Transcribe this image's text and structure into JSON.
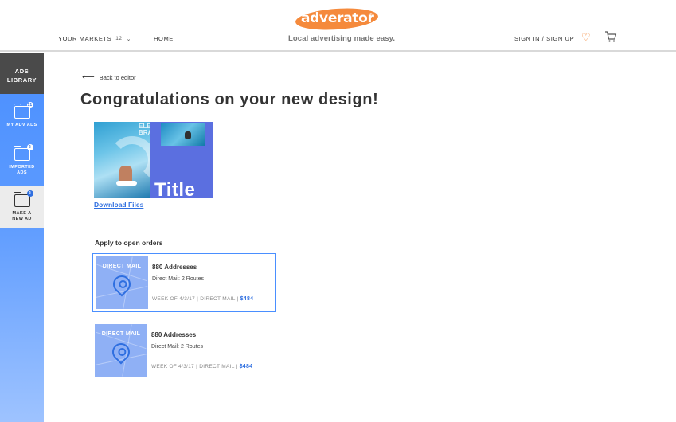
{
  "header": {
    "markets_label": "YOUR MARKETS",
    "markets_count": "12",
    "home_label": "HOME",
    "logo_text": "adverator",
    "logo_reg": "®",
    "tagline": "Local advertising made easy.",
    "sign_label": "SIGN IN / SIGN UP",
    "icons": {
      "markets_dropdown": "chevron-down-icon",
      "favorites": "heart-icon",
      "cart": "cart-icon"
    }
  },
  "sidebar": {
    "title_line1": "ADS",
    "title_line2": "LIBRARY",
    "items": [
      {
        "line1": "MY ADV ADS",
        "line2": "",
        "badge": "11",
        "icon": "folder-icon"
      },
      {
        "line1": "IMPORTED",
        "line2": "ADS",
        "badge": "2",
        "icon": "folder-icon"
      },
      {
        "line1": "MAKE A",
        "line2": "NEW AD",
        "badge": "2",
        "icon": "folder-icon",
        "active": true
      }
    ]
  },
  "main": {
    "back_label": "Back to editor",
    "title": "Congratulations on your new design!",
    "preview": {
      "tag": "ELE BRAD",
      "title": "Title"
    },
    "download_label": "Download Files",
    "orders_label": "Apply to open orders",
    "orders": [
      {
        "thumb_label": "DIRECT MAIL",
        "title": "880 Addresses",
        "subtitle": "Direct Mail: 2 Routes",
        "meta": "WEEK OF 4/3/17 | DIRECT MAIL | ",
        "price": "$484",
        "selected": true
      },
      {
        "thumb_label": "DIRECT MAIL",
        "title": "880 Addresses",
        "subtitle": "Direct Mail: 2 Routes",
        "meta": "WEEK OF 4/3/17 | DIRECT MAIL | ",
        "price": "$484",
        "selected": false
      }
    ]
  },
  "colors": {
    "brand_orange": "#f58a3c",
    "accent_blue": "#2f6fe0",
    "sidebar_blue": "#4a8fff",
    "sidebar_dark": "#4a4a4a"
  }
}
